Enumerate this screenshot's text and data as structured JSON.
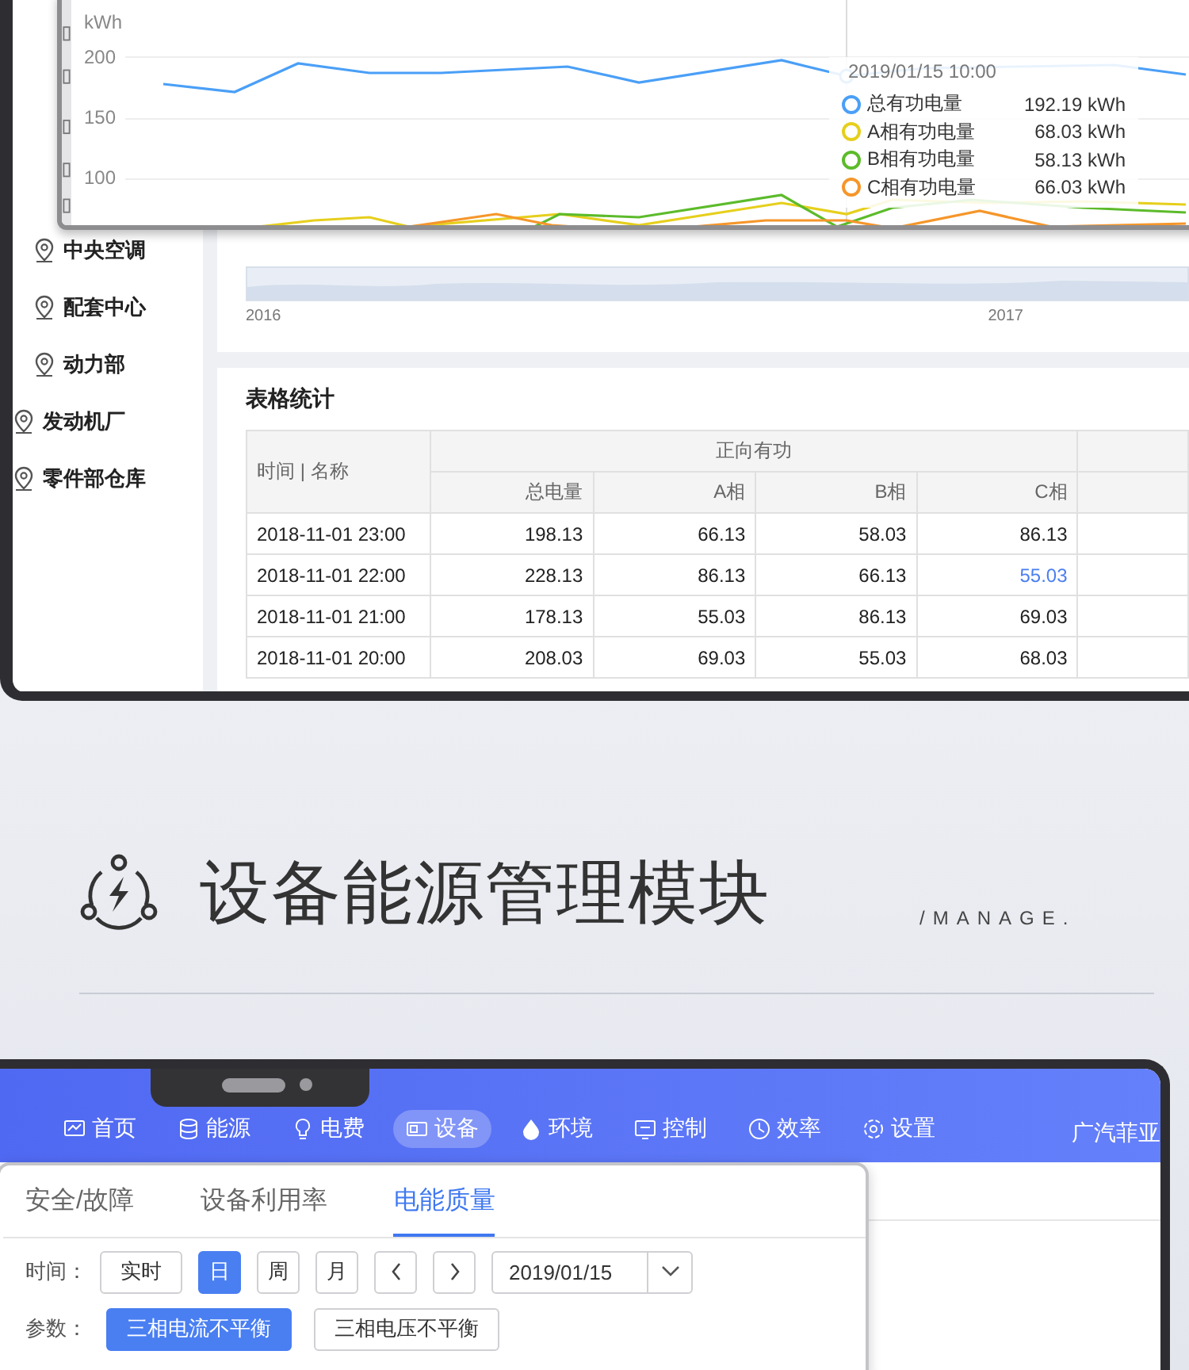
{
  "top_screen": {
    "sidebar": {
      "sub_items": [
        "中央空调",
        "配套中心",
        "动力部"
      ],
      "items": [
        "发动机厂",
        "零件部仓库"
      ]
    },
    "range_navigator": {
      "labels": [
        "2016",
        "2017"
      ]
    },
    "table": {
      "title": "表格统计",
      "group_header": "正向有功",
      "columns": [
        "时间 | 名称",
        "总电量",
        "A相",
        "B相",
        "C相"
      ],
      "rows": [
        {
          "cells": [
            {
              "text": "2018-11-01 23:00",
              "highlighted": false
            },
            {
              "text": "198.13",
              "highlighted": false
            },
            {
              "text": "66.13",
              "highlighted": false
            },
            {
              "text": "58.03",
              "highlighted": false
            },
            {
              "text": "86.13",
              "highlighted": false
            }
          ]
        },
        {
          "cells": [
            {
              "text": "2018-11-01 22:00",
              "highlighted": false
            },
            {
              "text": "228.13",
              "highlighted": false
            },
            {
              "text": "86.13",
              "highlighted": false
            },
            {
              "text": "66.13",
              "highlighted": false
            },
            {
              "text": "55.03",
              "highlighted": true
            }
          ]
        },
        {
          "cells": [
            {
              "text": "2018-11-01 21:00",
              "highlighted": false
            },
            {
              "text": "178.13",
              "highlighted": false
            },
            {
              "text": "55.03",
              "highlighted": false
            },
            {
              "text": "86.13",
              "highlighted": false
            },
            {
              "text": "69.03",
              "highlighted": false
            }
          ]
        },
        {
          "cells": [
            {
              "text": "2018-11-01 20:00",
              "highlighted": false
            },
            {
              "text": "208.03",
              "highlighted": false
            },
            {
              "text": "69.03",
              "highlighted": false
            },
            {
              "text": "55.03",
              "highlighted": false
            },
            {
              "text": "68.03",
              "highlighted": false
            }
          ]
        }
      ]
    }
  },
  "chart_card": {
    "unit": "kWh",
    "y_labels": [
      "200",
      "150",
      "100"
    ],
    "tooltip": {
      "time": "2019/01/15 10:00",
      "series": [
        {
          "name": "总有功电量",
          "value": "192.19 kWh",
          "color": "#4a9ff7"
        },
        {
          "name": "A相有功电量",
          "value": "68.03 kWh",
          "color": "#e6cf1c"
        },
        {
          "name": "B相有功电量",
          "value": "58.13 kWh",
          "color": "#5cbb2a"
        },
        {
          "name": "C相有功电量",
          "value": "66.03 kWh",
          "color": "#f5962a"
        }
      ]
    }
  },
  "module": {
    "title": "设备能源管理模块",
    "subtitle": "/MANAGE."
  },
  "bottom_screen": {
    "nav": [
      {
        "label": "首页",
        "selected": false
      },
      {
        "label": "能源",
        "selected": false
      },
      {
        "label": "电费",
        "selected": false
      },
      {
        "label": "设备",
        "selected": true
      },
      {
        "label": "环境",
        "selected": false
      },
      {
        "label": "控制",
        "selected": false
      },
      {
        "label": "效率",
        "selected": false
      },
      {
        "label": "设置",
        "selected": false
      }
    ],
    "company": "广汽菲亚",
    "tabs": [
      {
        "label": "安全/故障",
        "selected": false
      },
      {
        "label": "设备利用率",
        "selected": false
      },
      {
        "label": "电能质量",
        "selected": true
      }
    ],
    "time_filter": {
      "label": "时间：",
      "buttons": [
        {
          "label": "实时",
          "selected": false
        },
        {
          "label": "日",
          "selected": true
        },
        {
          "label": "周",
          "selected": false
        },
        {
          "label": "月",
          "selected": false
        }
      ],
      "date": "2019/01/15"
    },
    "param_filter": {
      "label": "参数：",
      "buttons": [
        {
          "label": "三相电流不平衡",
          "selected": true
        },
        {
          "label": "三相电压不平衡",
          "selected": false
        }
      ]
    }
  }
}
